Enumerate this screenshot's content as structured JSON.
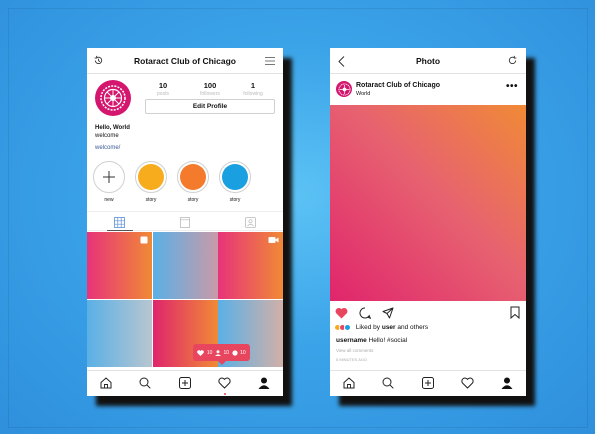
{
  "profile_screen": {
    "header": {
      "title": "Rotaract Club of Chicago",
      "history_icon": "history-icon",
      "menu_icon": "menu-icon"
    },
    "stats": [
      {
        "value": "10",
        "label": "posts"
      },
      {
        "value": "100",
        "label": "followers"
      },
      {
        "value": "1",
        "label": "following"
      }
    ],
    "edit_profile_label": "Edit Profile",
    "bio": {
      "name": "Hello, World",
      "text": "welcome",
      "link": "welcome/"
    },
    "highlights": [
      {
        "label": "new",
        "color": "#ffffff"
      },
      {
        "label": "story",
        "color": "#f7ac1e"
      },
      {
        "label": "story",
        "color": "#f47b2b"
      },
      {
        "label": "story",
        "color": "#1a9fe0"
      }
    ],
    "tabs": [
      "grid-icon",
      "feed-icon",
      "tagged-icon"
    ],
    "notification": {
      "likes": "10",
      "follows": "10",
      "comments": "10"
    },
    "nav": [
      "home-icon",
      "search-icon",
      "add-icon",
      "heart-icon",
      "profile-icon"
    ]
  },
  "photo_screen": {
    "header": {
      "title": "Photo",
      "back_icon": "back-icon",
      "refresh_icon": "refresh-icon"
    },
    "post": {
      "username": "Rotaract Club of Chicago",
      "location": "World",
      "more": "•••"
    },
    "liked_by": {
      "prefix": "Liked by ",
      "user": "user",
      "suffix": " and others"
    },
    "caption": {
      "username": "username",
      "text": " Hello! #social"
    },
    "view_all": "View all comments",
    "time_ago": "5 MINUTES AGO",
    "nav": [
      "home-icon",
      "search-icon",
      "add-icon",
      "heart-icon",
      "profile-icon"
    ]
  },
  "colors": {
    "accent": "#e8455e",
    "brand": "#d4166e",
    "background": "#3aa3e8"
  }
}
